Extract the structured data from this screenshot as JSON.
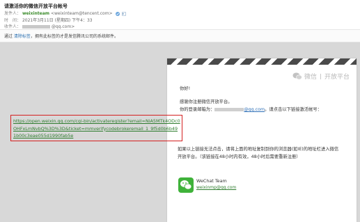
{
  "mail": {
    "subject": "请激活你的微信开放平台帐号",
    "from_label": "发件人：",
    "from_name": "weixinteam",
    "from_email": "<weixinteam@tencent.com>",
    "time_label": "时　间：",
    "time_value": "2021年3月11日 (星期四) 下午4：33",
    "to_label": "收件人：",
    "to_suffix": "@qq.com>"
  },
  "notice": {
    "prefix": "通过 ",
    "highlight": "清除标签",
    "text": "，拥有此标签的才是发信腾讯公司的系统邮件。"
  },
  "card": {
    "logo_text": "微信",
    "logo_sub": "开放平台",
    "greeting": "你好!",
    "line1": "感谢你注册微信开放平台。",
    "line2_prefix": "你的登录邮箱为：",
    "line2_email_suffix": "@qq.com",
    "line2_suffix": "。请点击以下链接激活帐号：",
    "activation_link": "https://open.weixin.qq.com/cgi-bin/activateregister?email=NiA5MTk4ODc0OHFxLmNvbQ%3D%3D&ticket=mmverifycodebrokeremail_1_9f5d0b6b491b00c3eae055d1990fab5e",
    "fallback_line1": "如果以上链接无法点击，请将上面的地址复制到你的浏览器(如IE)的地址栏进入微信",
    "fallback_line2": "开放平台。（该链接在48小时内有效，48小时后需要重新注册）",
    "team_name": "WeChat Team",
    "team_email": "weixinmp@qq.com"
  },
  "colors": {
    "accent_green": "#3fb23a",
    "link_green": "#2e7d2e",
    "highlight_red": "#d41f1f",
    "link_blue": "#2e6fb7"
  },
  "icons": [
    "wechat-logo-icon",
    "wechat-team-icon",
    "verified-icon"
  ]
}
